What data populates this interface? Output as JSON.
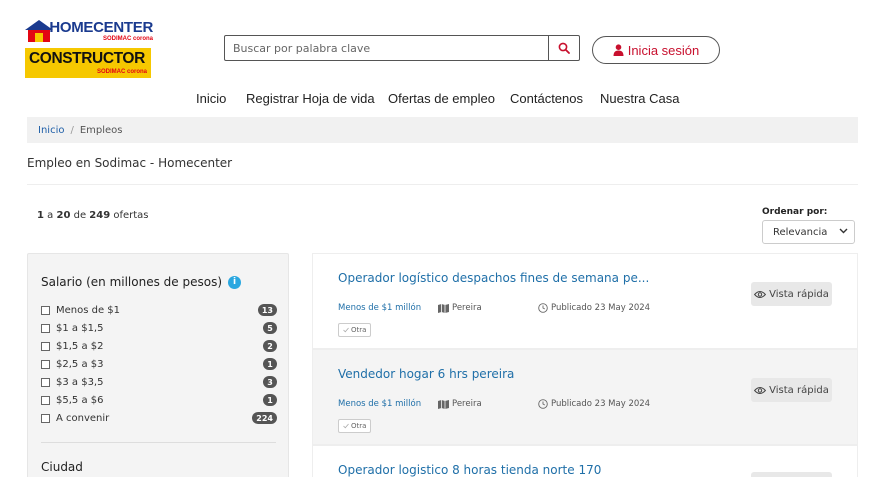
{
  "brand": {
    "home_name": "HOMECENTER",
    "home_sub": "SODIMAC corona",
    "constructor_name": "CONSTRUCTOR",
    "constructor_sub": "SODIMAC corona"
  },
  "search": {
    "placeholder": "Buscar por palabra clave",
    "icon": "search-icon"
  },
  "login": {
    "label": "Inicia sesión",
    "icon": "user-icon"
  },
  "nav": [
    "Inicio",
    "Registrar Hoja de vida",
    "Ofertas de empleo",
    "Contáctenos",
    "Nuestra Casa"
  ],
  "breadcrumb": {
    "home": "Inicio",
    "separator": "/",
    "current": "Empleos"
  },
  "page_title": "Empleo en Sodimac - Homecenter",
  "results": {
    "from": "1",
    "a": "a",
    "to": "20",
    "de": "de",
    "total": "249",
    "suffix": "ofertas"
  },
  "sort": {
    "label": "Ordenar por:",
    "value": "Relevancia"
  },
  "filters": {
    "salary_title": "Salario (en millones de pesos)",
    "salary_items": [
      {
        "label": "Menos de $1",
        "count": "13"
      },
      {
        "label": "$1 a $1,5",
        "count": "5"
      },
      {
        "label": "$1,5 a $2",
        "count": "2"
      },
      {
        "label": "$2,5 a $3",
        "count": "1"
      },
      {
        "label": "$3 a $3,5",
        "count": "3"
      },
      {
        "label": "$5,5 a $6",
        "count": "1"
      },
      {
        "label": "A convenir",
        "count": "224"
      }
    ],
    "city_title": "Ciudad"
  },
  "jobs": [
    {
      "title": "Operador logístico despachos fines de semana pe...",
      "salary": "Menos de $1 millón",
      "city": "Pereira",
      "published": "Publicado 23 May 2024",
      "tag": "Otra",
      "quick_view": "Vista rápida"
    },
    {
      "title": "Vendedor hogar 6 hrs pereira",
      "salary": "Menos de $1 millón",
      "city": "Pereira",
      "published": "Publicado 23 May 2024",
      "tag": "Otra",
      "quick_view": "Vista rápida"
    },
    {
      "title": "Operador logistico 8 horas tienda norte 170"
    }
  ],
  "colors": {
    "brand_red": "#c8102e",
    "link_blue": "#1f6fa8",
    "info_blue": "#2aa7e0",
    "logo_yellow": "#f6c800",
    "logo_navy": "#1a3a8f"
  }
}
